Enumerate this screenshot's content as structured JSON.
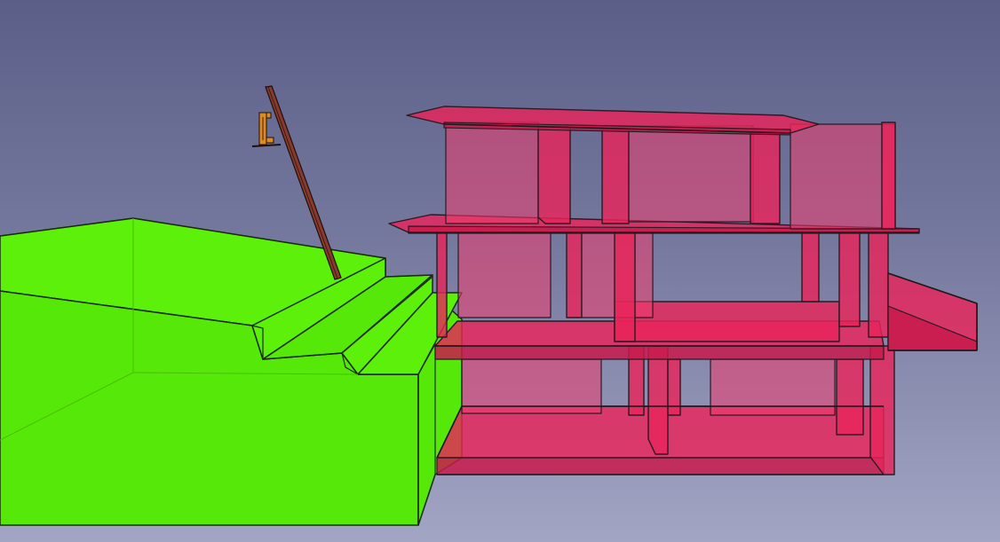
{
  "viewport": {
    "background_top": "#5b5f88",
    "background_bottom": "#a3a5c4"
  },
  "scene": {
    "terrain_color": "#5cf00a",
    "building_color": "#e8245a",
    "crane_color": "#e08a1e"
  }
}
